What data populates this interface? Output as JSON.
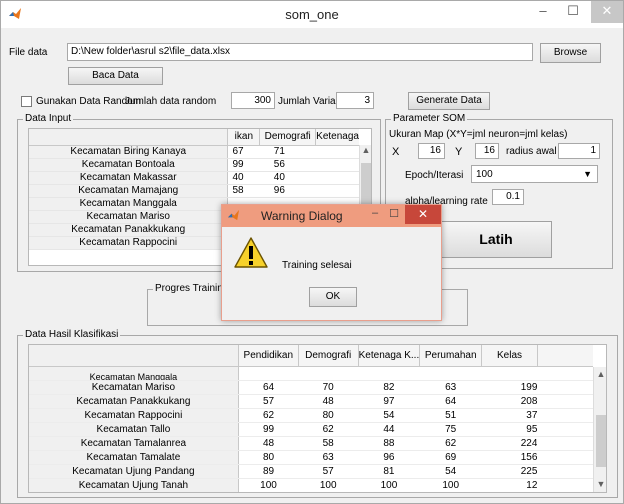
{
  "window": {
    "title": "som_one"
  },
  "file": {
    "label": "File data",
    "path": "D:\\New folder\\asrul s2\\file_data.xlsx",
    "browse_label": "Browse",
    "read_label": "Baca Data"
  },
  "random": {
    "checkbox_label": "Gunakan Data Random",
    "count_label": "Jumlah data random",
    "count_value": "300",
    "vars_label": "Jumlah Variabel",
    "vars_value": "3",
    "generate_label": "Generate Data"
  },
  "data_input": {
    "title": "Data Input",
    "headers": [
      "ikan",
      "Demografi",
      "Ketenaga"
    ],
    "rows": [
      {
        "name": "Kecamatan Biring Kanaya",
        "a": "67",
        "b": "71"
      },
      {
        "name": "Kecamatan Bontoala",
        "a": "99",
        "b": "56"
      },
      {
        "name": "Kecamatan Makassar",
        "a": "40",
        "b": "40"
      },
      {
        "name": "Kecamatan Mamajang",
        "a": "58",
        "b": "96"
      },
      {
        "name": "Kecamatan Manggala",
        "a": "",
        "b": ""
      },
      {
        "name": "Kecamatan Mariso",
        "a": "",
        "b": ""
      },
      {
        "name": "Kecamatan Panakkukang",
        "a": "",
        "b": ""
      },
      {
        "name": "Kecamatan Rappocini",
        "a": "",
        "b": ""
      }
    ]
  },
  "som": {
    "title": "Parameter SOM",
    "map_label": "Ukuran Map (X*Y=jml neuron=jml kelas)",
    "x_label": "X",
    "x_value": "16",
    "y_label": "Y",
    "y_value": "16",
    "radius_label": "radius awal",
    "radius_value": "1",
    "epoch_label": "Epoch/Iterasi",
    "epoch_value": "100",
    "alpha_label": "alpha/learning rate",
    "alpha_value": "0.1",
    "train_label": "Latih"
  },
  "progress": {
    "title": "Progres Training"
  },
  "dialog": {
    "title": "Warning Dialog",
    "message": "Training selesai",
    "ok_label": "OK"
  },
  "results": {
    "title": "Data Hasil Klasifikasi",
    "headers": [
      "Pendidikan",
      "Demografi",
      "Ketenaga K...",
      "Perumahan",
      "Kelas"
    ],
    "rows": [
      {
        "name": "Kecamatan Manggala",
        "p": "",
        "d": "",
        "k": "",
        "r": "",
        "c": ""
      },
      {
        "name": "Kecamatan Mariso",
        "p": "64",
        "d": "70",
        "k": "82",
        "r": "63",
        "c": "199"
      },
      {
        "name": "Kecamatan Panakkukang",
        "p": "57",
        "d": "48",
        "k": "97",
        "r": "64",
        "c": "208"
      },
      {
        "name": "Kecamatan Rappocini",
        "p": "62",
        "d": "80",
        "k": "54",
        "r": "51",
        "c": "37"
      },
      {
        "name": "Kecamatan Tallo",
        "p": "99",
        "d": "62",
        "k": "44",
        "r": "75",
        "c": "95"
      },
      {
        "name": "Kecamatan Tamalanrea",
        "p": "48",
        "d": "58",
        "k": "88",
        "r": "62",
        "c": "224"
      },
      {
        "name": "Kecamatan Tamalate",
        "p": "80",
        "d": "63",
        "k": "96",
        "r": "69",
        "c": "156"
      },
      {
        "name": "Kecamatan Ujung Pandang",
        "p": "89",
        "d": "57",
        "k": "81",
        "r": "54",
        "c": "225"
      },
      {
        "name": "Kecamatan Ujung Tanah",
        "p": "100",
        "d": "100",
        "k": "100",
        "r": "100",
        "c": "12"
      }
    ]
  },
  "icons": {
    "app": "matlab-icon",
    "warning": "warning-icon"
  },
  "colors": {
    "dialog_title": "#ef9c7f",
    "close_red": "#c7473a",
    "warning_yellow": "#f7d12a"
  }
}
